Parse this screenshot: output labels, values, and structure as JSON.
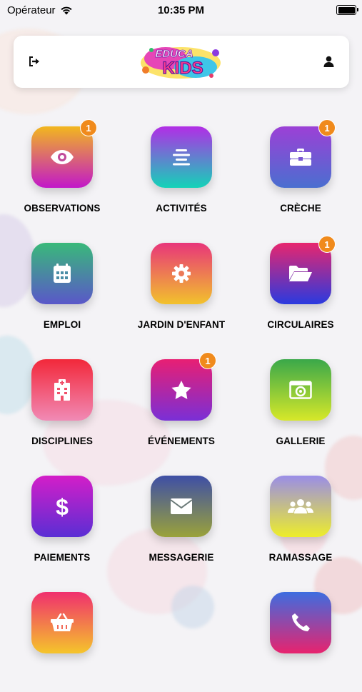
{
  "status_bar": {
    "carrier": "Opérateur",
    "time": "10:35 PM"
  },
  "header": {
    "logo_top": "EDUCA",
    "logo_bottom": "KIDS",
    "logout_icon": "logout-icon",
    "profile_icon": "user-icon"
  },
  "tiles": [
    {
      "label": "OBSERVATIONS",
      "icon": "eye-icon",
      "badge": "1",
      "gradient": [
        "#f2b71e",
        "#c218c9"
      ]
    },
    {
      "label": "ACTIVITÉS",
      "icon": "align-center-icon",
      "badge": "",
      "gradient": [
        "#b22de6",
        "#13d3b8"
      ]
    },
    {
      "label": "CRÈCHE",
      "icon": "briefcase-icon",
      "badge": "1",
      "gradient": [
        "#9c40d6",
        "#4a6fd0"
      ]
    },
    {
      "label": "EMPLOI",
      "icon": "calendar-icon",
      "badge": "",
      "gradient": [
        "#39b97a",
        "#5a57c9"
      ]
    },
    {
      "label": "JARDIN D'ENFANT",
      "icon": "gear-icon",
      "badge": "",
      "gradient": [
        "#e8357a",
        "#f2c22c"
      ]
    },
    {
      "label": "CIRCULAIRES",
      "icon": "folder-open-icon",
      "badge": "1",
      "gradient": [
        "#e8266e",
        "#2a3adf"
      ]
    },
    {
      "label": "DISCIPLINES",
      "icon": "hospital-building-icon",
      "badge": "",
      "gradient": [
        "#f2283a",
        "#f18ab5"
      ]
    },
    {
      "label": "ÉVÉNEMENTS",
      "icon": "star-icon",
      "badge": "1",
      "gradient": [
        "#e81f73",
        "#7a2fd6"
      ]
    },
    {
      "label": "GALLERIE",
      "icon": "photo-frame-icon",
      "badge": "",
      "gradient": [
        "#3aa84a",
        "#d7e829"
      ]
    },
    {
      "label": "PAIEMENTS",
      "icon": "dollar-icon",
      "badge": "",
      "gradient": [
        "#d41ec8",
        "#5a2ed4"
      ]
    },
    {
      "label": "MESSAGERIE",
      "icon": "envelope-icon",
      "badge": "",
      "gradient": [
        "#3e4fa6",
        "#9aa23a"
      ]
    },
    {
      "label": "RAMASSAGE",
      "icon": "users-icon",
      "badge": "",
      "gradient": [
        "#9a8de8",
        "#eded2a"
      ]
    },
    {
      "label": "",
      "icon": "shopping-basket-icon",
      "badge": "",
      "gradient": [
        "#f02f6e",
        "#f5c52b"
      ]
    },
    {
      "label": "",
      "icon": "phone-icon",
      "badge": "",
      "gradient": [
        "#3d6de0",
        "#e8236e"
      ]
    }
  ]
}
